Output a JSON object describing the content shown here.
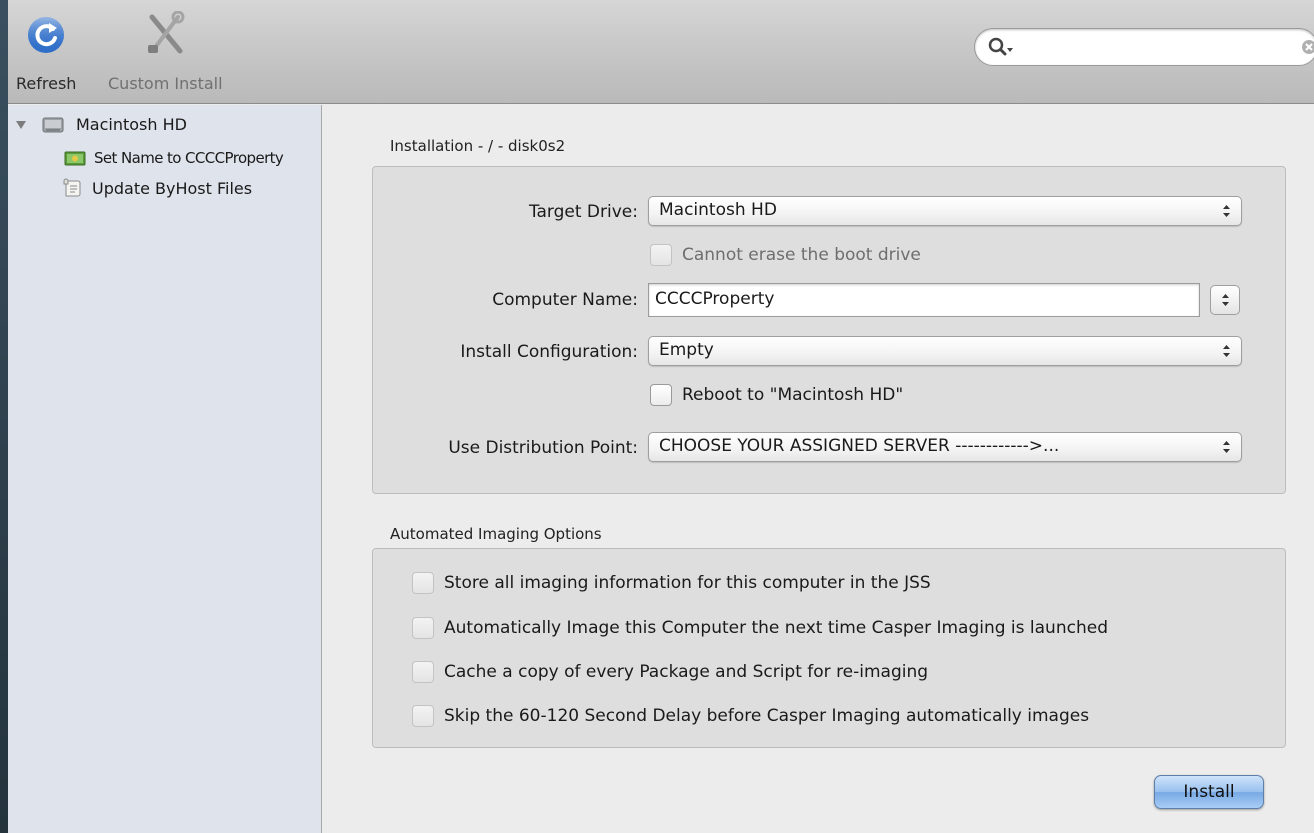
{
  "toolbar": {
    "refresh_label": "Refresh",
    "custom_install_label": "Custom Install",
    "search": {
      "value": "",
      "placeholder": ""
    }
  },
  "sidebar": {
    "root": {
      "label": "Macintosh HD",
      "expanded": true,
      "icon": "hard-drive-icon"
    },
    "items": [
      {
        "label": "Set Name to CCCCProperty",
        "icon": "rename-config-icon"
      },
      {
        "label": "Update ByHost Files",
        "icon": "script-icon"
      }
    ]
  },
  "installation": {
    "title": "Installation - / - disk0s2",
    "target_drive": {
      "label": "Target Drive:",
      "value": "Macintosh HD"
    },
    "erase_checkbox": {
      "label": "Cannot erase the boot drive",
      "checked": false,
      "enabled": false
    },
    "computer_name": {
      "label": "Computer Name:",
      "value": "CCCCProperty"
    },
    "install_configuration": {
      "label": "Install Configuration:",
      "value": "Empty"
    },
    "reboot_checkbox": {
      "label": "Reboot to \"Macintosh HD\"",
      "checked": false,
      "enabled": true
    },
    "distribution_point": {
      "label": "Use Distribution Point:",
      "value": "CHOOSE YOUR ASSIGNED SERVER ------------>..."
    }
  },
  "automated": {
    "title": "Automated Imaging Options",
    "options": [
      {
        "label": "Store all imaging information for this computer in the JSS",
        "checked": false
      },
      {
        "label": "Automatically Image this Computer the next time Casper Imaging is launched",
        "checked": false
      },
      {
        "label": "Cache a copy of every Package and Script for re-imaging",
        "checked": false
      },
      {
        "label": "Skip the 60-120 Second Delay before Casper Imaging automatically images",
        "checked": false
      }
    ]
  },
  "install_button_label": "Install",
  "colors": {
    "accent": "#78a9e4",
    "sidebar_bg": "#dfe4ec",
    "window_bg": "#ececec"
  }
}
